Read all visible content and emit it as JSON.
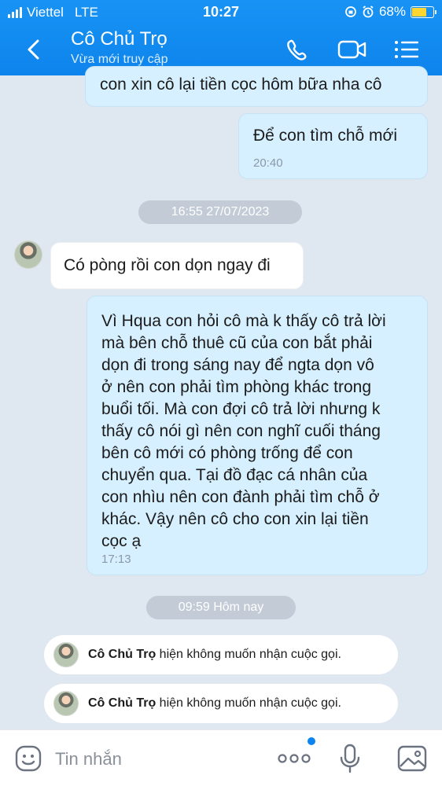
{
  "status_bar": {
    "carrier": "Viettel",
    "network": "LTE",
    "time": "10:27",
    "battery_percent": "68%",
    "battery_level": 0.68
  },
  "header": {
    "title": "Cô Chủ Trọ",
    "subtitle": "Vừa mới truy cập"
  },
  "messages": [
    {
      "direction": "out",
      "text": "con xin cô lại tiền cọc hôm bữa nha cô",
      "time": ""
    },
    {
      "direction": "out",
      "text": "Để con tìm chỗ mới",
      "time": "20:40"
    },
    {
      "direction": "in",
      "text": "Có pòng rồi con dọn ngay đi",
      "time": ""
    },
    {
      "direction": "out",
      "lines": [
        "Vì Hqua con hỏi cô mà k thấy cô trả lời",
        "mà bên chỗ thuê cũ của con bắt phải",
        "dọn đi trong sáng nay để ngta dọn vô",
        "ở nên con phải tìm phòng khác trong",
        "buổi tối. Mà con đợi cô trả lời nhưng k",
        "thấy cô nói gì nên con nghĩ cuối tháng",
        "bên cô mới có phòng trống để con",
        "chuyển qua. Tại đồ đạc cá nhân của",
        "con nhìu nên con đành phải tìm chỗ ở",
        "khác. Vậy nên cô cho con xin lại tiền",
        "cọc ạ"
      ],
      "time": "17:13"
    }
  ],
  "date_separators": [
    "16:55 27/07/2023",
    "09:59 Hôm nay"
  ],
  "call_notices": [
    {
      "name": "Cô Chủ Trọ",
      "text": "hiện không muốn nhận cuộc gọi."
    },
    {
      "name": "Cô Chủ Trọ",
      "text": "hiện không muốn nhận cuộc gọi."
    }
  ],
  "input": {
    "placeholder": "Tin nhắn"
  },
  "colors": {
    "header": "#0d84ec",
    "outgoing_bubble": "#d7f0ff",
    "incoming_bubble": "#ffffff",
    "background": "#dfe7f1"
  },
  "icons": {
    "back": "chevron-left-icon",
    "call": "phone-icon",
    "video": "video-camera-icon",
    "menu": "list-menu-icon",
    "emoji": "emoji-icon",
    "more": "more-dots-icon",
    "mic": "microphone-icon",
    "image": "image-icon"
  }
}
